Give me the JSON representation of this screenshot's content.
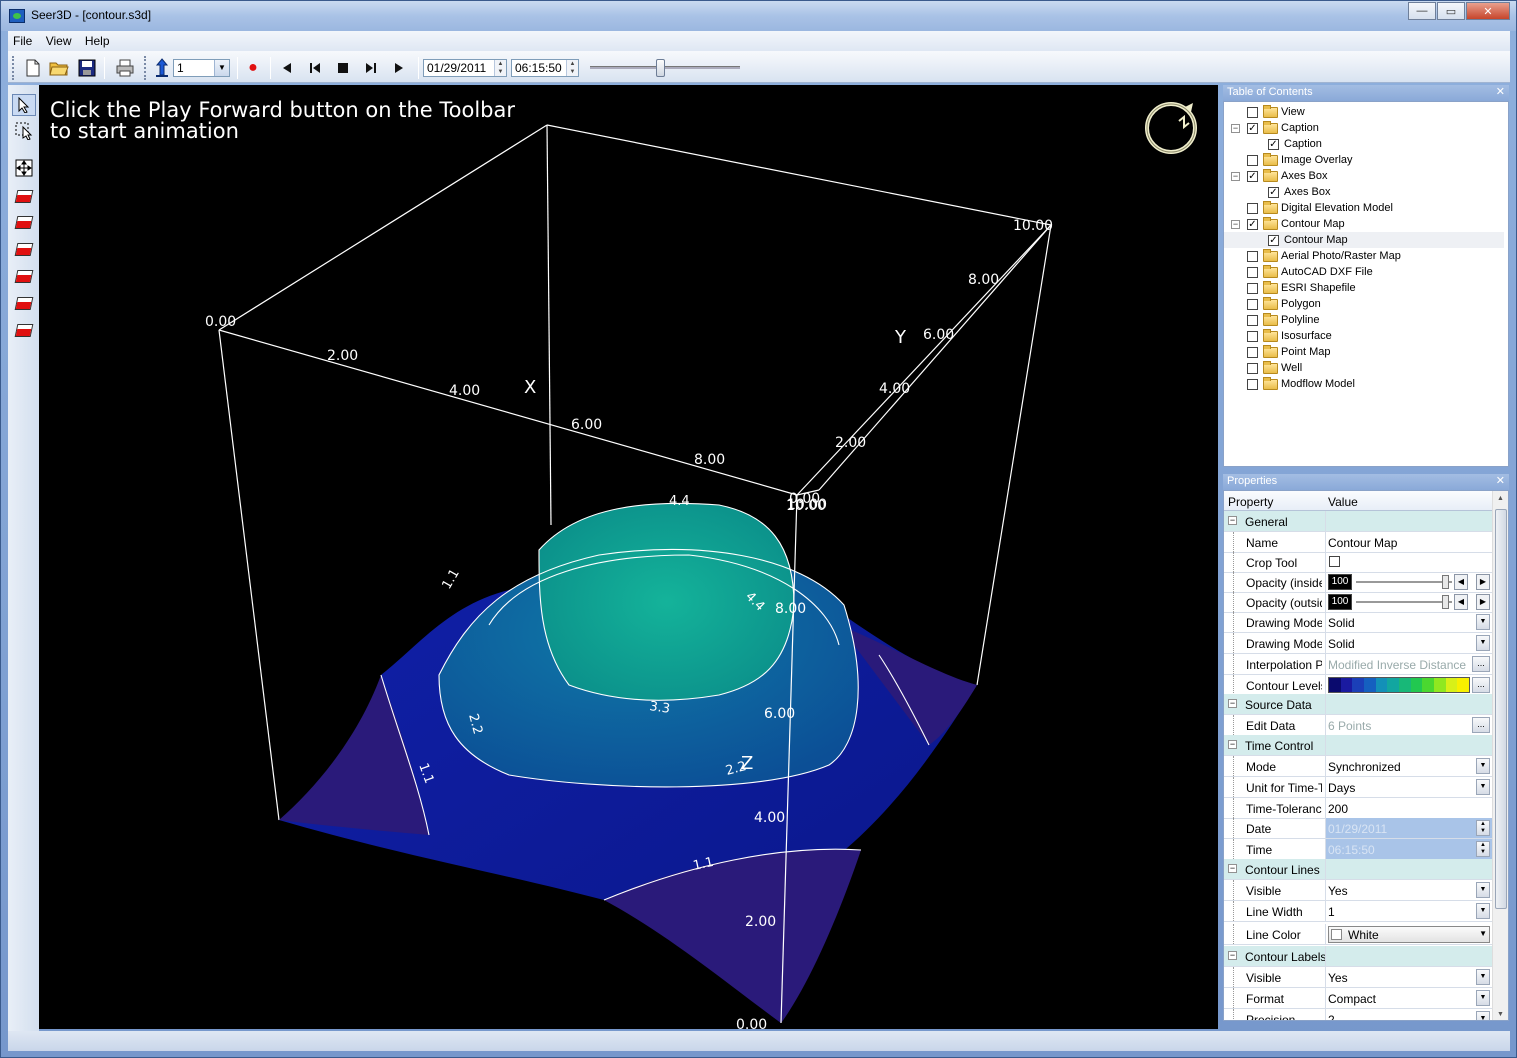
{
  "window": {
    "title": "Seer3D - [contour.s3d]",
    "controls": {
      "minimize": "—",
      "maximize": "▭",
      "close": "✕"
    }
  },
  "menu": [
    "File",
    "View",
    "Help"
  ],
  "toolbar": {
    "layer_value": "1",
    "date": "01/29/2011",
    "time": "06:15:50",
    "time_slider_position": 0.47
  },
  "viewport": {
    "caption": "Click the Play Forward button on the Toolbar\nto start animation",
    "axes": {
      "x_label": "X",
      "y_label": "Y",
      "z_label": "Z",
      "x_ticks": [
        "0.00",
        "2.00",
        "4.00",
        "6.00",
        "8.00",
        "10.00"
      ],
      "y_ticks": [
        "0.00",
        "2.00",
        "4.00",
        "6.00",
        "8.00",
        "10.00"
      ],
      "z_ticks": [
        "0.00",
        "2.00",
        "4.00",
        "6.00",
        "8.00",
        "10.00"
      ]
    },
    "contour_labels": [
      "1.1",
      "1.1",
      "1.1",
      "2.2",
      "2.2",
      "3.3",
      "4.4",
      "4.4"
    ],
    "colors": {
      "low": "#2a1a7a",
      "mid": "#0d1e9a",
      "high": "#0d6a9e",
      "peak": "#10a890"
    }
  },
  "toc": {
    "title": "Table of Contents",
    "items": [
      {
        "label": "View",
        "checked": false,
        "level": 0,
        "expander": false
      },
      {
        "label": "Caption",
        "checked": true,
        "level": 0,
        "expander": true
      },
      {
        "label": "Caption",
        "checked": true,
        "level": 1,
        "expander": false
      },
      {
        "label": "Image Overlay",
        "checked": false,
        "level": 0,
        "expander": false
      },
      {
        "label": "Axes Box",
        "checked": true,
        "level": 0,
        "expander": true
      },
      {
        "label": "Axes Box",
        "checked": true,
        "level": 1,
        "expander": false
      },
      {
        "label": "Digital Elevation Model",
        "checked": false,
        "level": 0,
        "expander": false
      },
      {
        "label": "Contour Map",
        "checked": true,
        "level": 0,
        "expander": true
      },
      {
        "label": "Contour Map",
        "checked": true,
        "level": 1,
        "expander": false,
        "selected": true
      },
      {
        "label": "Aerial Photo/Raster Map",
        "checked": false,
        "level": 0,
        "expander": false
      },
      {
        "label": "AutoCAD DXF File",
        "checked": false,
        "level": 0,
        "expander": false
      },
      {
        "label": "ESRI Shapefile",
        "checked": false,
        "level": 0,
        "expander": false
      },
      {
        "label": "Polygon",
        "checked": false,
        "level": 0,
        "expander": false
      },
      {
        "label": "Polyline",
        "checked": false,
        "level": 0,
        "expander": false
      },
      {
        "label": "Isosurface",
        "checked": false,
        "level": 0,
        "expander": false
      },
      {
        "label": "Point Map",
        "checked": false,
        "level": 0,
        "expander": false
      },
      {
        "label": "Well",
        "checked": false,
        "level": 0,
        "expander": false
      },
      {
        "label": "Modflow Model",
        "checked": false,
        "level": 0,
        "expander": false
      }
    ]
  },
  "properties": {
    "title": "Properties",
    "col_property": "Property",
    "col_value": "Value",
    "rows": [
      {
        "type": "cat",
        "name": "General"
      },
      {
        "type": "text",
        "name": "Name",
        "value": "Contour Map"
      },
      {
        "type": "check",
        "name": "Crop Tool",
        "value": ""
      },
      {
        "type": "slider",
        "name": "Opacity (inside d",
        "value": "100"
      },
      {
        "type": "slider",
        "name": "Opacity (outside",
        "value": "100"
      },
      {
        "type": "dropdown",
        "name": "Drawing Mode (",
        "value": "Solid"
      },
      {
        "type": "dropdown",
        "name": "Drawing Mode (",
        "value": "Solid"
      },
      {
        "type": "ellipsis",
        "name": "Interpolation Par",
        "value": "Modified Inverse Distance",
        "disabled": true
      },
      {
        "type": "ramp",
        "name": "Contour Levels",
        "value": ""
      },
      {
        "type": "cat",
        "name": "Source Data"
      },
      {
        "type": "ellipsis",
        "name": "Edit Data",
        "value": "6 Points",
        "disabled": true
      },
      {
        "type": "cat",
        "name": "Time Control"
      },
      {
        "type": "dropdown",
        "name": "Mode",
        "value": "Synchronized"
      },
      {
        "type": "dropdown",
        "name": "Unit for Time-To",
        "value": "Days"
      },
      {
        "type": "text",
        "name": "Time-Tolerance",
        "value": "200"
      },
      {
        "type": "spin",
        "name": "Date",
        "value": "01/29/2011",
        "disabled": true
      },
      {
        "type": "spin",
        "name": "Time",
        "value": "06:15:50",
        "disabled": true
      },
      {
        "type": "cat",
        "name": "Contour Lines"
      },
      {
        "type": "dropdown",
        "name": "Visible",
        "value": "Yes"
      },
      {
        "type": "dropdown",
        "name": "Line Width",
        "value": "1"
      },
      {
        "type": "color",
        "name": "Line Color",
        "value": "White"
      },
      {
        "type": "cat",
        "name": "Contour Labels"
      },
      {
        "type": "dropdown",
        "name": "Visible",
        "value": "Yes"
      },
      {
        "type": "dropdown",
        "name": "Format",
        "value": "Compact"
      },
      {
        "type": "dropdown",
        "name": "Precision",
        "value": "2"
      }
    ],
    "ramp_colors": [
      "#0a0a6e",
      "#1a1aa0",
      "#1b3fb8",
      "#1560c0",
      "#1390b8",
      "#12a6a0",
      "#18b878",
      "#22c850",
      "#4ad830",
      "#90e820",
      "#d8f018",
      "#f8f000"
    ]
  }
}
